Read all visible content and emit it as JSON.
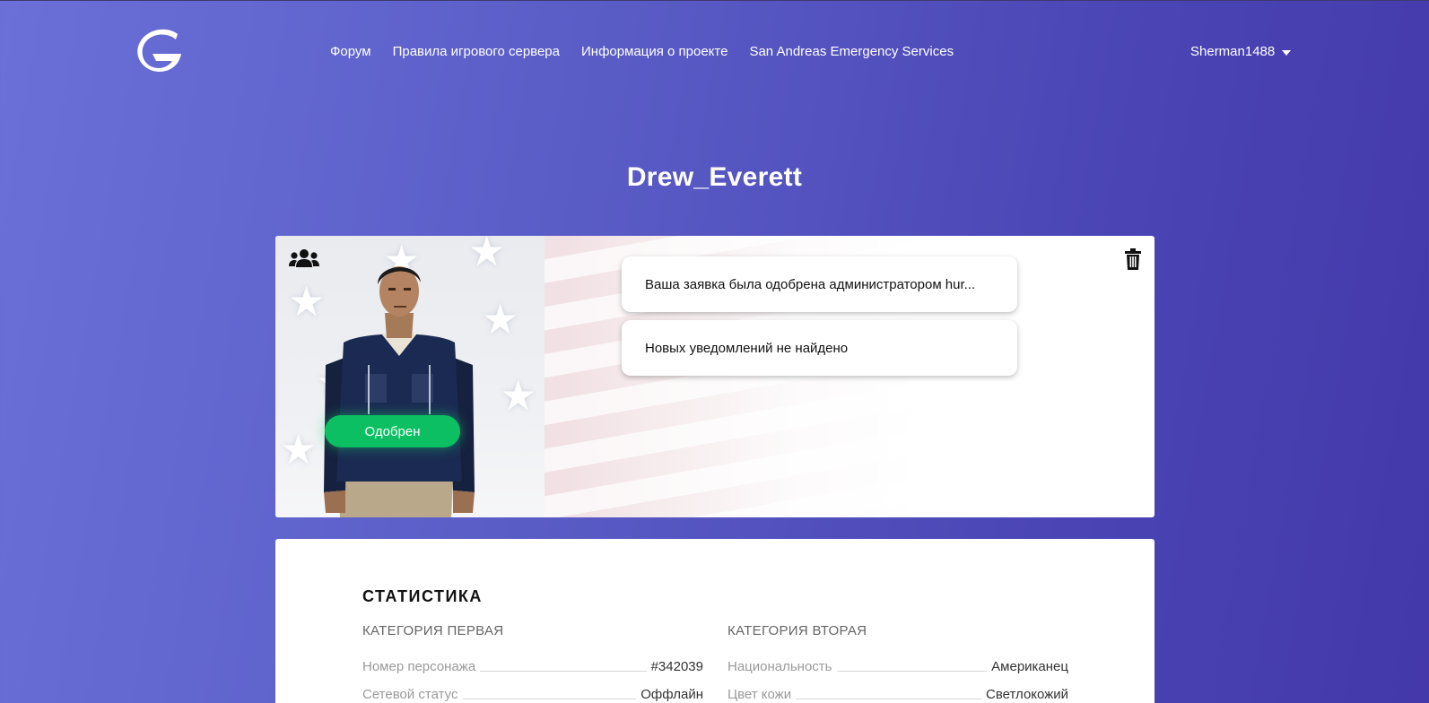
{
  "header": {
    "nav": [
      {
        "label": "Форум"
      },
      {
        "label": "Правила игрового сервера"
      },
      {
        "label": "Информация о проекте"
      },
      {
        "label": "San Andreas Emergency Services"
      }
    ],
    "username": "Sherman1488"
  },
  "profile": {
    "name": "Drew_Everett",
    "status": "Одобрен",
    "notifications": [
      "Ваша заявка была одобрена администратором hur...",
      "Новых уведомлений не найдено"
    ]
  },
  "stats": {
    "title": "СТАТИСТИКА",
    "categories": [
      {
        "title": "КАТЕГОРИЯ ПЕРВАЯ",
        "rows": [
          {
            "label": "Номер персонажа",
            "value": "#342039"
          },
          {
            "label": "Сетевой статус",
            "value": "Оффлайн"
          }
        ]
      },
      {
        "title": "КАТЕГОРИЯ ВТОРАЯ",
        "rows": [
          {
            "label": "Национальность",
            "value": "Американец"
          },
          {
            "label": "Цвет кожи",
            "value": "Светлокожий"
          }
        ]
      }
    ]
  },
  "colors": {
    "status_green": "#0bbf62",
    "bg_gradient_start": "#6a70d8",
    "bg_gradient_end": "#4438aa"
  },
  "icons": [
    "logo-g-icon",
    "caret-down-icon",
    "user-group-icon",
    "trash-icon"
  ]
}
